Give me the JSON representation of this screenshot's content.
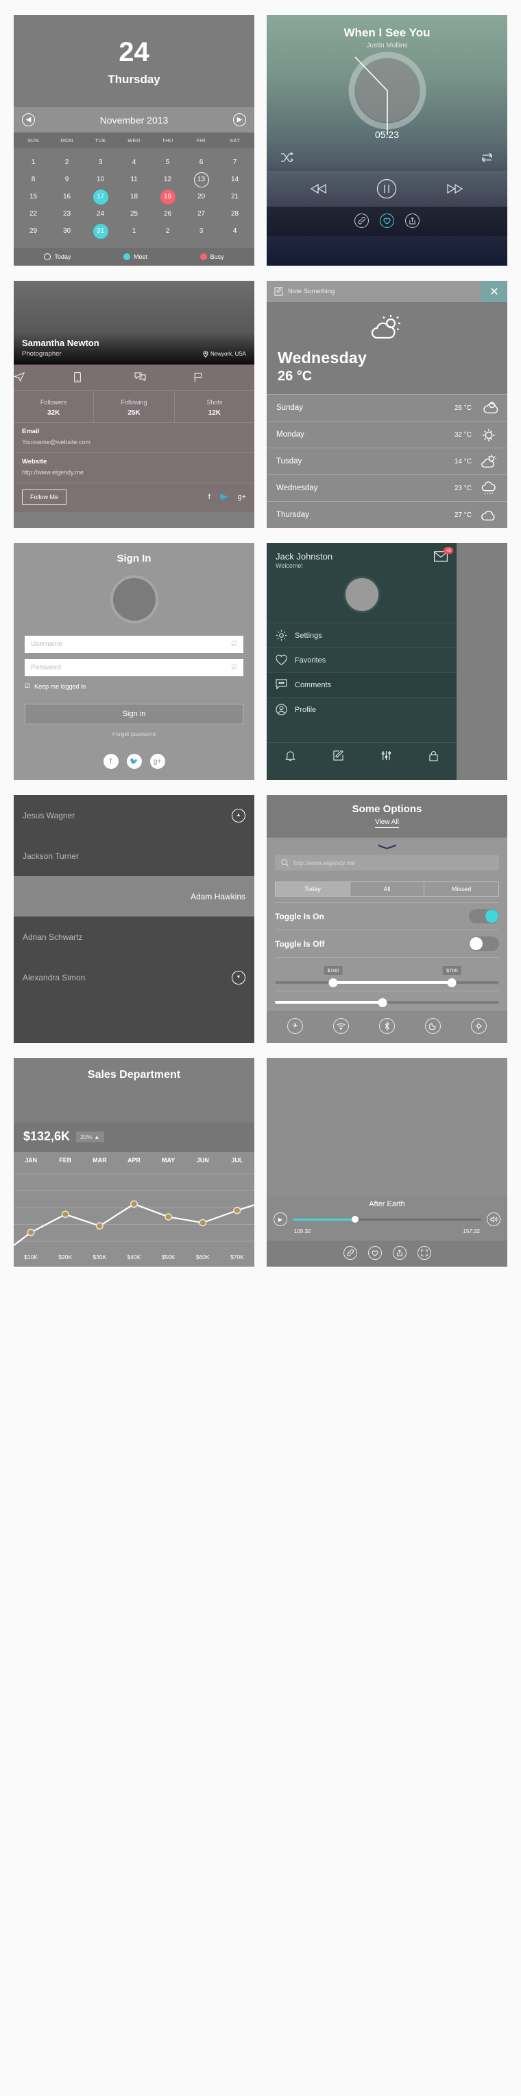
{
  "calendar": {
    "day_number": "24",
    "day_name": "Thursday",
    "month_label": "November 2013",
    "prev_icon": "chevron-left-icon",
    "next_icon": "chevron-right-icon",
    "dows": [
      "SUN",
      "MON",
      "TUE",
      "WED",
      "THU",
      "FRI",
      "SAT"
    ],
    "days": [
      {
        "n": "1"
      },
      {
        "n": "2"
      },
      {
        "n": "3"
      },
      {
        "n": "4"
      },
      {
        "n": "5"
      },
      {
        "n": "6"
      },
      {
        "n": "7"
      },
      {
        "n": "8"
      },
      {
        "n": "9"
      },
      {
        "n": "10"
      },
      {
        "n": "11"
      },
      {
        "n": "12"
      },
      {
        "n": "13",
        "state": "today"
      },
      {
        "n": "14"
      },
      {
        "n": "15"
      },
      {
        "n": "16"
      },
      {
        "n": "17",
        "state": "meet"
      },
      {
        "n": "18"
      },
      {
        "n": "19",
        "state": "busy"
      },
      {
        "n": "20"
      },
      {
        "n": "21"
      },
      {
        "n": "22"
      },
      {
        "n": "23"
      },
      {
        "n": "24"
      },
      {
        "n": "25"
      },
      {
        "n": "26"
      },
      {
        "n": "27"
      },
      {
        "n": "28"
      },
      {
        "n": "29"
      },
      {
        "n": "30"
      },
      {
        "n": "31",
        "state": "meet"
      },
      {
        "n": "1"
      },
      {
        "n": "2"
      },
      {
        "n": "3"
      },
      {
        "n": "4"
      }
    ],
    "legend": [
      {
        "label": "Today",
        "state": "hollow"
      },
      {
        "label": "Meet",
        "state": "meet",
        "color": "#4ed4dd"
      },
      {
        "label": "Busy",
        "state": "busy",
        "color": "#f9626f"
      }
    ]
  },
  "music": {
    "title": "When I See You",
    "artist": "Justin Mullins",
    "time": "05:23",
    "shuffle_icon": "shuffle-icon",
    "repeat_icon": "repeat-icon",
    "prev_icon": "rewind-icon",
    "play_icon": "pause-icon",
    "next_icon": "fast-forward-icon",
    "social": [
      {
        "icon": "link-icon",
        "active": false
      },
      {
        "icon": "heart-icon",
        "active": true
      },
      {
        "icon": "share-icon",
        "active": false
      }
    ],
    "accent": "#4ed4dd"
  },
  "profile": {
    "name": "Samantha Newton",
    "role": "Photographer",
    "location": "Newyork, USA",
    "location_icon": "map-pin-icon",
    "action_icons": [
      "send-icon",
      "phone-icon",
      "chat-icon",
      "flag-icon"
    ],
    "stats": [
      {
        "label": "Followers",
        "value": "32K"
      },
      {
        "label": "Following",
        "value": "25K"
      },
      {
        "label": "Shots",
        "value": "12K"
      }
    ],
    "rows": [
      {
        "label": "Email",
        "value": "Yourname@website.com"
      },
      {
        "label": "Website",
        "value": "http://www.elgendy.me"
      }
    ],
    "follow_label": "Follow Me",
    "socials": [
      "facebook-icon",
      "twitter-icon",
      "google-plus-icon"
    ]
  },
  "weather": {
    "note_label": "Note Something",
    "note_icon": "compose-icon",
    "close_icon": "close-icon",
    "current_icon": "sun-behind-cloud-icon",
    "current_day": "Wednesday",
    "current_temp": "26 °C",
    "forecast": [
      {
        "day": "Sunday",
        "temp": "26 °C",
        "icon": "cloud-moon-icon"
      },
      {
        "day": "Monday",
        "temp": "32 °C",
        "icon": "sun-icon"
      },
      {
        "day": "Tusday",
        "temp": "14 °C",
        "icon": "sun-behind-cloud-icon"
      },
      {
        "day": "Wednesday",
        "temp": "23 °C",
        "icon": "rain-cloud-icon"
      },
      {
        "day": "Thursday",
        "temp": "27 °C",
        "icon": "cloud-icon"
      }
    ]
  },
  "signin": {
    "title": "Sign In",
    "avatar": "user-avatar",
    "username_placeholder": "Username",
    "password_placeholder": "Password",
    "check_icon": "check-box-icon",
    "keep_label": "Keep me logged in",
    "submit_label": "Sign in",
    "forgot_label": "Forget password",
    "socials": [
      "facebook-icon",
      "twitter-icon",
      "google-plus-icon"
    ],
    "accent": "#3fd6de"
  },
  "drawer": {
    "name": "Jack Johnston",
    "welcome": "Welcome!",
    "mail_icon": "envelope-icon",
    "badge": "+9",
    "badge_color": "#ef5350",
    "avatar": "user-avatar",
    "items": [
      {
        "label": "Settings",
        "icon": "gear-icon",
        "active": false
      },
      {
        "label": "Favorites",
        "icon": "heart-icon",
        "active": false
      },
      {
        "label": "Comments",
        "icon": "comment-icon",
        "active": true
      },
      {
        "label": "Profile",
        "icon": "profile-icon",
        "active": false
      }
    ],
    "bottom_icons": [
      "bell-icon",
      "compose-icon",
      "sliders-icon",
      "lock-icon"
    ]
  },
  "contacts": {
    "collapse_icon": "chevron-up-circle-icon",
    "expand_icon": "chevron-down-circle-icon",
    "items": [
      {
        "name": "Jesus Wagner",
        "selected": false,
        "align": "left"
      },
      {
        "name": "Jackson Turner",
        "selected": false,
        "align": "left"
      },
      {
        "name": "Adam Hawkins",
        "selected": true,
        "align": "right"
      },
      {
        "name": "Adrian Schwartz",
        "selected": false,
        "align": "left"
      },
      {
        "name": "Alexandra Simon",
        "selected": false,
        "align": "left"
      }
    ]
  },
  "options": {
    "title": "Some Options",
    "view_all": "View All",
    "chevron_icon": "chevron-down-icon",
    "search_icon": "search-icon",
    "search_placeholder": "http://www.elgendy.me",
    "segments": [
      "Today",
      "All",
      "Missed"
    ],
    "segment_selected": "Today",
    "toggle_on_label": "Toggle Is On",
    "toggle_off_label": "Toggle Is Off",
    "range_min_label": "$100",
    "range_max_label": "$700",
    "range_min_pct": 26,
    "range_max_pct": 79,
    "single_slider_pct": 48,
    "footer_icons": [
      "airplane-icon",
      "wifi-icon",
      "bluetooth-icon",
      "moon-icon",
      "location-icon"
    ],
    "accent": "#3fd6de"
  },
  "sales": {
    "title": "Sales Department",
    "value": "$132,6K",
    "change": "20%",
    "change_icon": "triangle-up-icon"
  },
  "chart_data": {
    "type": "line",
    "title": "Sales Department",
    "categories": [
      "JAN",
      "FEB",
      "MAR",
      "APR",
      "MAY",
      "JUN",
      "JUL"
    ],
    "x_tick_labels": [
      "JAN",
      "FEB",
      "MAR",
      "APR",
      "MAY",
      "JUN",
      "JUL"
    ],
    "bottom_tick_labels": [
      "$10K",
      "$20K",
      "$30K",
      "$40K",
      "$50K",
      "$60K",
      "$70K"
    ],
    "values": [
      18,
      46,
      28,
      62,
      42,
      33,
      52
    ],
    "ylim": [
      0,
      100
    ],
    "xlabel": "",
    "ylabel": "",
    "grid": true,
    "legend": false,
    "line_color": "#ffffff",
    "point_color": "#b8944d",
    "total_label": "$132,6K",
    "change_label": "20%"
  },
  "video": {
    "title": "After Earth",
    "play_icon": "play-icon",
    "volume_icon": "volume-icon",
    "elapsed": "105:32",
    "duration": "157:32",
    "progress_pct": 33,
    "footer_icons": [
      "link-icon",
      "heart-icon",
      "share-icon",
      "fullscreen-icon"
    ],
    "accent": "#3fd6de"
  }
}
